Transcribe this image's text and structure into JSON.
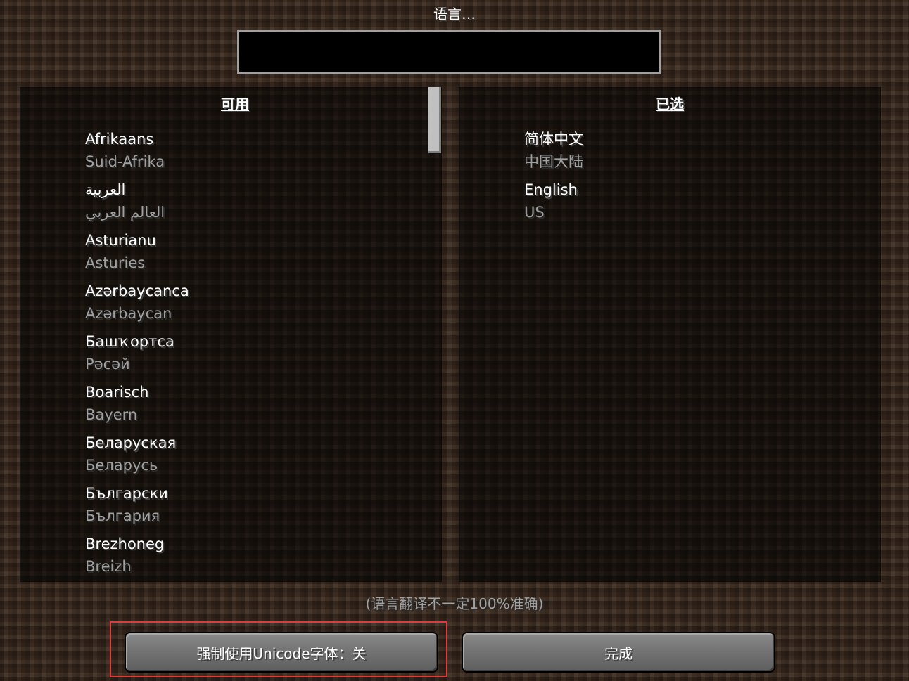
{
  "screen": {
    "title": "语言…"
  },
  "search": {
    "value": ""
  },
  "available": {
    "header": "可用",
    "items": [
      {
        "name": "Afrikaans",
        "region": "Suid-Afrika"
      },
      {
        "name": "العربية",
        "region": "العالم العربي"
      },
      {
        "name": "Asturianu",
        "region": "Asturies"
      },
      {
        "name": "Azərbaycanca",
        "region": "Azərbaycan"
      },
      {
        "name": "Башҡортса",
        "region": "Рәсәй"
      },
      {
        "name": "Boarisch",
        "region": "Bayern"
      },
      {
        "name": "Беларуская",
        "region": "Беларусь"
      },
      {
        "name": "Български",
        "region": "България"
      },
      {
        "name": "Brezhoneg",
        "region": "Breizh"
      }
    ]
  },
  "selected": {
    "header": "已选",
    "items": [
      {
        "name": "简体中文",
        "region": "中国大陆"
      },
      {
        "name": "English",
        "region": "US"
      }
    ]
  },
  "warning": "(语言翻译不一定100%准确)",
  "buttons": {
    "force_unicode": "强制使用Unicode字体：关",
    "done": "完成"
  },
  "colors": {
    "highlight": "#e03a3a"
  }
}
